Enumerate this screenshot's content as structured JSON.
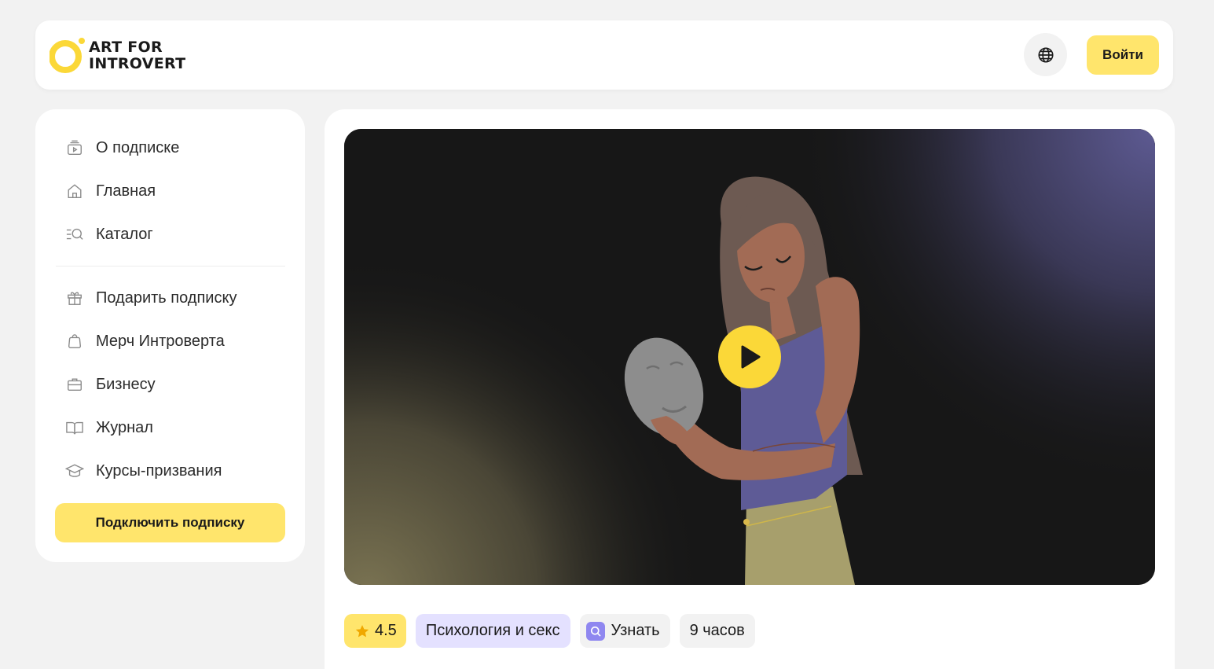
{
  "header": {
    "logo_line1": "ART FOR",
    "logo_line2": "INTROVERT",
    "login_label": "Войти"
  },
  "sidebar": {
    "items": [
      {
        "label": "О подписке",
        "icon": "subscription-icon"
      },
      {
        "label": "Главная",
        "icon": "home-icon"
      },
      {
        "label": "Каталог",
        "icon": "catalog-search-icon"
      },
      {
        "label": "Подарить подписку",
        "icon": "gift-icon"
      },
      {
        "label": "Мерч Интроверта",
        "icon": "shopping-bag-icon"
      },
      {
        "label": "Бизнесу",
        "icon": "briefcase-icon"
      },
      {
        "label": "Журнал",
        "icon": "book-icon"
      },
      {
        "label": "Курсы-призвания",
        "icon": "graduation-cap-icon"
      }
    ],
    "subscribe_label": "Подключить подписку"
  },
  "course": {
    "rating": "4.5",
    "category": "Психология и секс",
    "learn_label": "Узнать",
    "duration": "9 часов"
  },
  "colors": {
    "accent_yellow": "#ffe56c",
    "play_yellow": "#fbd838",
    "category_bg": "#e4e1ff",
    "learn_icon_bg": "#8f87f0"
  }
}
